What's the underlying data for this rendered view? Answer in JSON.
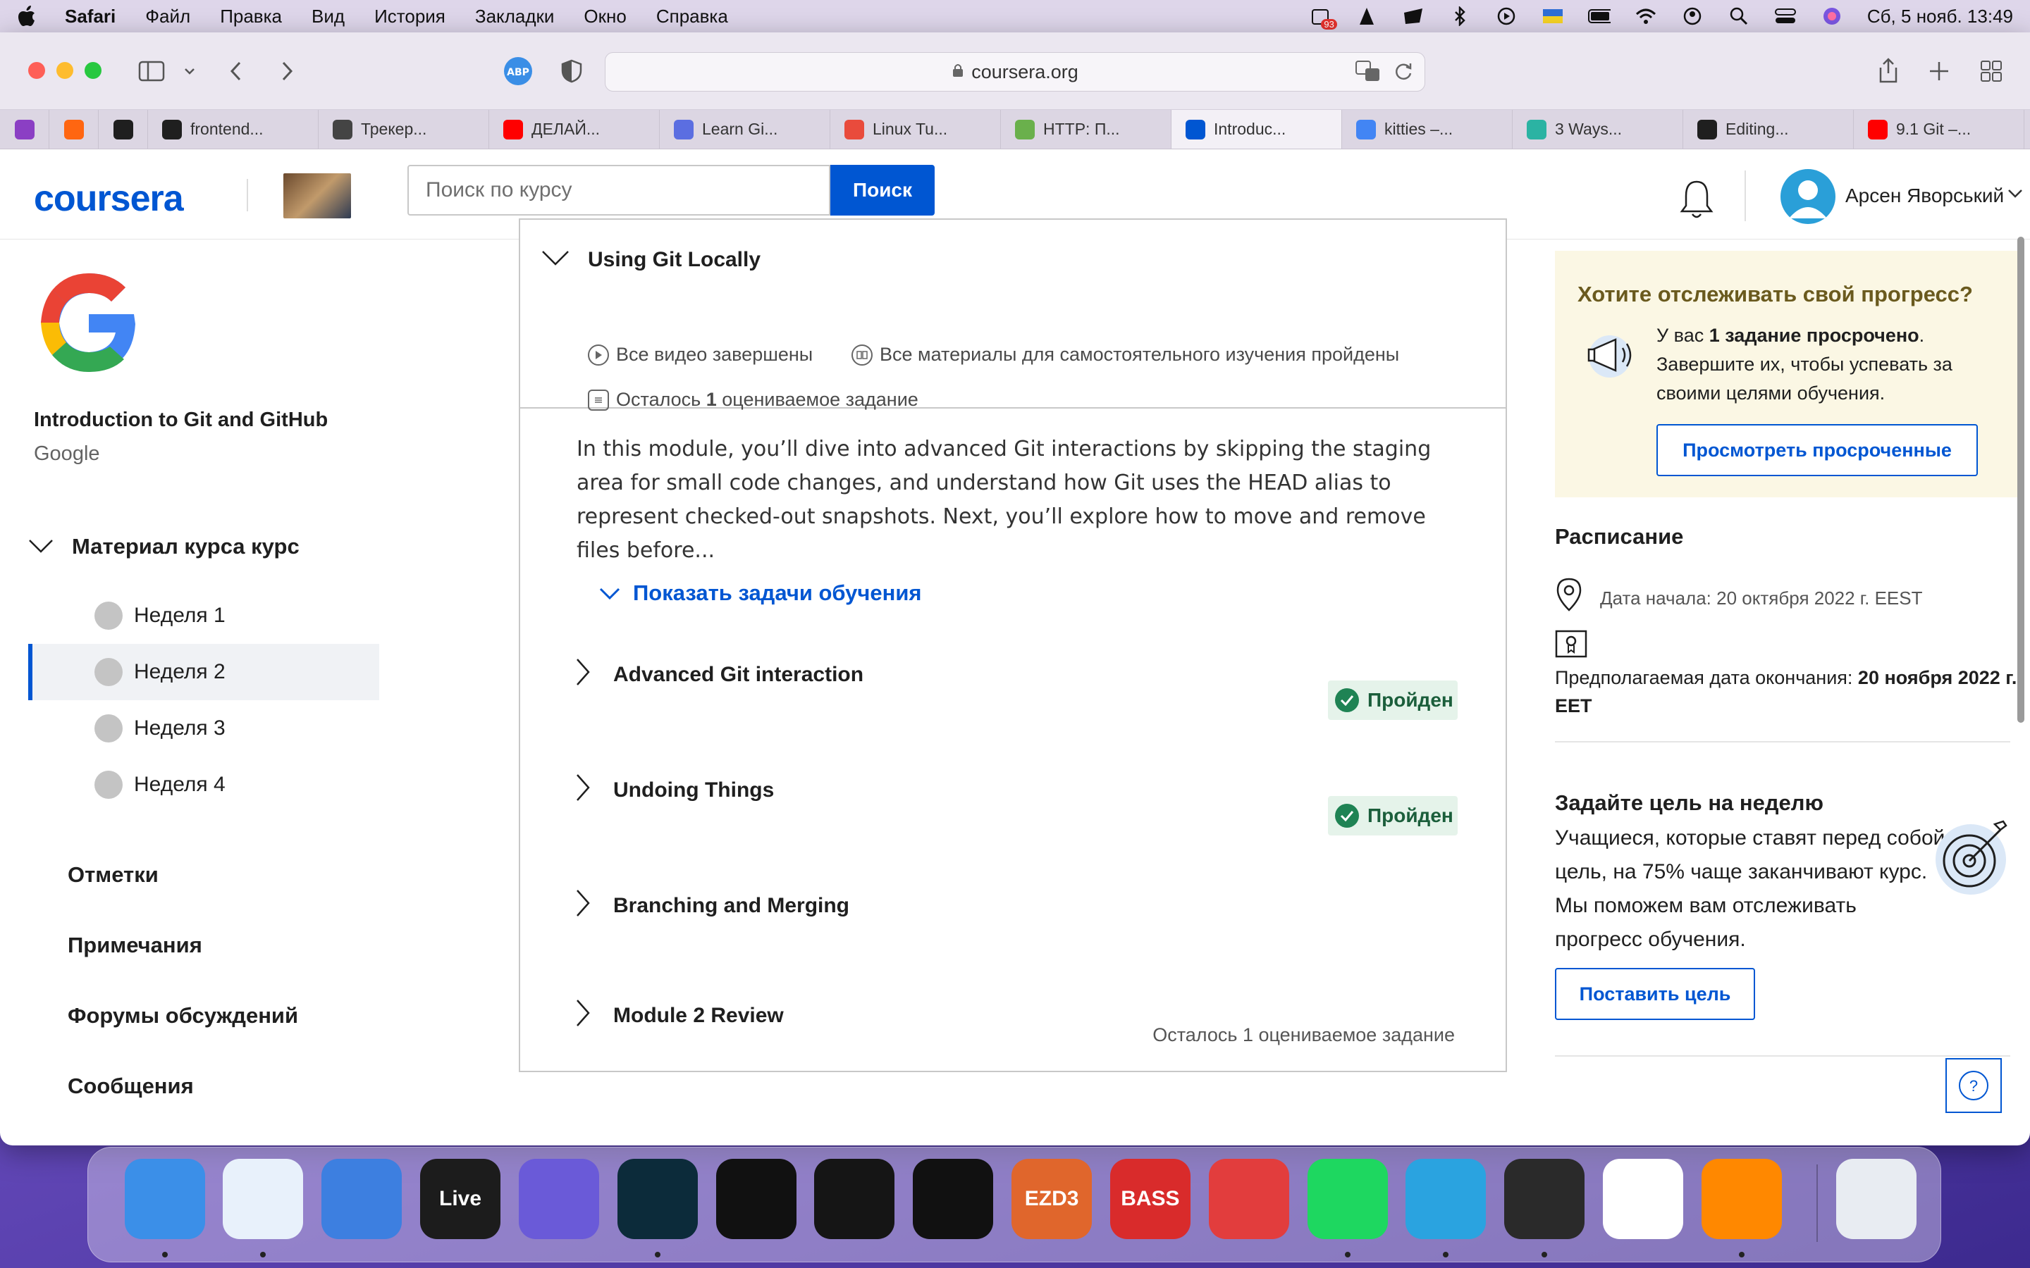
{
  "menubar": {
    "app": "Safari",
    "items": [
      "Файл",
      "Правка",
      "Вид",
      "История",
      "Закладки",
      "Окно",
      "Справка"
    ],
    "badge": "93",
    "clock": "Сб, 5 нояб.  13:49"
  },
  "browser": {
    "url": "coursera.org",
    "abp_label": "ABP",
    "tabs": [
      {
        "label": "",
        "color": "#8b3fc4"
      },
      {
        "label": "",
        "color": "#ff6611"
      },
      {
        "label": "",
        "color": "#1f1f1f"
      },
      {
        "label": "frontend...",
        "color": "#1f1f1f"
      },
      {
        "label": "Трекер...",
        "color": "#444444"
      },
      {
        "label": "ДЕЛАЙ...",
        "color": "#ff0000"
      },
      {
        "label": "Learn Gi...",
        "color": "#5b6ee1"
      },
      {
        "label": "Linux Tu...",
        "color": "#e94b3c"
      },
      {
        "label": "HTTP: П...",
        "color": "#6ab04c"
      },
      {
        "label": "Introduc...",
        "color": "#0056d2"
      },
      {
        "label": "kitties –...",
        "color": "#4285f4"
      },
      {
        "label": "3 Ways...",
        "color": "#2bb3a3"
      },
      {
        "label": "Editing...",
        "color": "#1f1f1f"
      },
      {
        "label": "9.1 Git –...",
        "color": "#ff0000"
      }
    ]
  },
  "header": {
    "logo": "coursera",
    "search_placeholder": "Поиск по курсу",
    "search_button": "Поиск",
    "user_name": "Арсен Яворський"
  },
  "sidebar": {
    "course_title": "Introduction to Git and GitHub",
    "course_org": "Google",
    "material_heading": "Материал курса курс",
    "weeks": [
      "Неделя 1",
      "Неделя 2",
      "Неделя 3",
      "Неделя 4"
    ],
    "links": [
      "Отметки",
      "Примечания",
      "Форумы обсуждений",
      "Сообщения"
    ]
  },
  "module": {
    "title": "Using Git Locally",
    "meta_videos": "Все видео завершены",
    "meta_readings": "Все материалы для самостоятельного изучения пройдены",
    "meta_remaining_pre": "Осталось ",
    "meta_remaining_num": "1",
    "meta_remaining_post": " оцениваемое задание",
    "description": "In this module, you’ll dive into advanced Git interactions by skipping the staging area for small code changes, and understand how Git uses the HEAD alias to represent checked-out snapshots. Next, you’ll explore how to move and remove files before...",
    "show_goals": "Показать задачи обучения",
    "lessons": [
      {
        "title": "Advanced Git interaction",
        "status": "Пройден"
      },
      {
        "title": "Undoing Things",
        "status": "Пройден"
      },
      {
        "title": "Branching and Merging",
        "status": ""
      },
      {
        "title": "Module 2 Review",
        "status": "Осталось 1 оцениваемое задание"
      }
    ]
  },
  "right": {
    "promo_title": "Хотите отслеживать свой прогресс?",
    "promo_text_pre": "У вас ",
    "promo_text_bold": "1 задание просрочено",
    "promo_text_post": ". Завершите их, чтобы успевать за своими целями обучения.",
    "promo_button": "Просмотреть просроченные",
    "schedule_title": "Расписание",
    "start_date": "Дата начала: 20 октября 2022 г. EEST",
    "end_label": "Предполагаемая дата окончания: ",
    "end_date": "20 ноября 2022 г. EET",
    "goal_title": "Задайте цель на неделю",
    "goal_text": "Учащиеся, которые ставят перед собой цель, на 75% чаще заканчивают курс. Мы поможем вам отслеживать прогресс обучения.",
    "goal_button": "Поставить цель",
    "help_label": "?"
  },
  "dock": {
    "apps": [
      {
        "name": "Finder",
        "label": "",
        "color": "#3b8fe8",
        "running": true
      },
      {
        "name": "Safari",
        "label": "",
        "color": "#e8f1fb",
        "running": true
      },
      {
        "name": "Spark",
        "label": "",
        "color": "#3d7fe0",
        "running": false
      },
      {
        "name": "Ableton Live",
        "label": "Live",
        "color": "#1c1c1c",
        "running": false
      },
      {
        "name": "Siri",
        "label": "",
        "color": "#6a5ad8",
        "running": false
      },
      {
        "name": "Lasso",
        "label": "",
        "color": "#0c2b3a",
        "running": true
      },
      {
        "name": "Beast",
        "label": "",
        "color": "#111111",
        "running": false
      },
      {
        "name": "DP",
        "label": "",
        "color": "#151515",
        "running": false
      },
      {
        "name": "Serato",
        "label": "",
        "color": "#111111",
        "running": false
      },
      {
        "name": "EZdrummer",
        "label": "EZD3",
        "color": "#e0662c",
        "running": false
      },
      {
        "name": "Bass",
        "label": "BASS",
        "color": "#d92b2b",
        "running": false
      },
      {
        "name": "Bear",
        "label": "",
        "color": "#e23d3d",
        "running": false
      },
      {
        "name": "Spotify",
        "label": "",
        "color": "#1ed760",
        "running": true
      },
      {
        "name": "Telegram",
        "label": "",
        "color": "#2aa3e0",
        "running": true
      },
      {
        "name": "Piano",
        "label": "",
        "color": "#2a2a2a",
        "running": true
      },
      {
        "name": "VS Code",
        "label": "",
        "color": "#ffffff",
        "running": false
      },
      {
        "name": "VLC",
        "label": "",
        "color": "#ff8800",
        "running": true
      },
      {
        "name": "Trash",
        "label": "",
        "color": "#e8ecf2",
        "running": false
      }
    ]
  }
}
